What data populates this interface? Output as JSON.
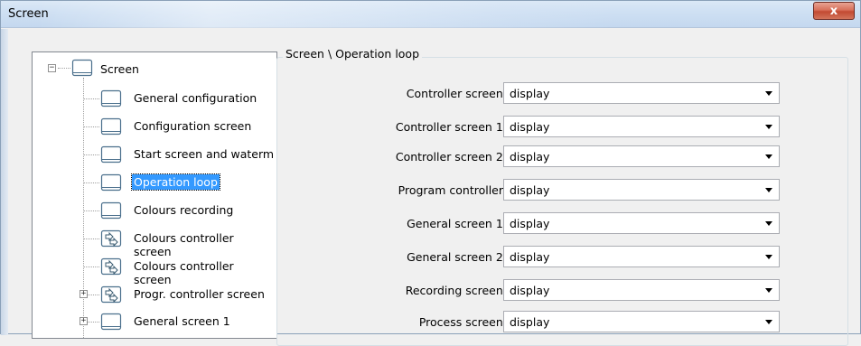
{
  "window": {
    "title": "Screen",
    "close_label": "x"
  },
  "tree": {
    "root": {
      "label": "Screen",
      "icon": "screen-icon",
      "expander": "minus"
    },
    "items": [
      {
        "label": "General configuration",
        "icon": "screen-icon",
        "selected": false,
        "expander": null
      },
      {
        "label": "Configuration screen",
        "icon": "screen-icon",
        "selected": false,
        "expander": null
      },
      {
        "label": "Start screen and waterm",
        "icon": "screen-icon",
        "selected": false,
        "expander": null
      },
      {
        "label": "Operation loop",
        "icon": "screen-icon",
        "selected": true,
        "expander": null
      },
      {
        "label": "Colours recording",
        "icon": "screen-icon",
        "selected": false,
        "expander": null
      },
      {
        "label": "Colours controller screen",
        "icon": "program-screen-icon",
        "selected": false,
        "expander": null
      },
      {
        "label": "Colours controller screen",
        "icon": "program-screen-icon",
        "selected": false,
        "expander": null
      },
      {
        "label": "Progr. controller screen",
        "icon": "program-screen-icon",
        "selected": false,
        "expander": "plus"
      },
      {
        "label": "General screen 1",
        "icon": "screen-icon",
        "selected": false,
        "expander": "plus"
      }
    ]
  },
  "panel": {
    "title": "Screen \\ Operation loop",
    "fields": [
      {
        "label": "Controller screen:",
        "value": "display"
      },
      {
        "label": "Controller screen 1:",
        "value": "display"
      },
      {
        "label": "Controller screen 2:",
        "value": "display"
      },
      {
        "label": "Program controller:",
        "value": "display"
      },
      {
        "label": "General screen 1:",
        "value": "display"
      },
      {
        "label": "General screen 2:",
        "value": "display"
      },
      {
        "label": "Recording screen:",
        "value": "display"
      },
      {
        "label": "Process screen:",
        "value": "display"
      }
    ]
  },
  "colors": {
    "selection": "#3399ff",
    "titlebar": "#cfe0f3",
    "close_button": "#c24a32"
  }
}
